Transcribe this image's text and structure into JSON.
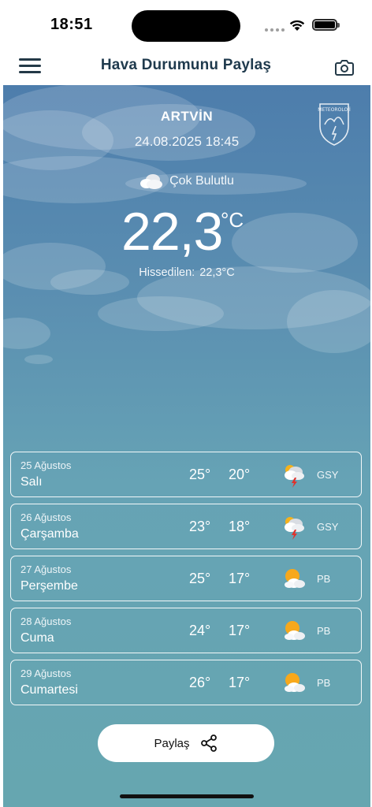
{
  "status_bar": {
    "time": "18:51"
  },
  "nav": {
    "title": "Hava Durumunu Paylaş"
  },
  "current": {
    "city": "ARTVİN",
    "datetime": "24.08.2025 18:45",
    "condition": "Çok Bulutlu",
    "temperature": "22,3",
    "unit": "°C",
    "feels_label": "Hissedilen:",
    "feels_value": "22,3°C",
    "logo_text": "METEOROLOJİ"
  },
  "forecast": [
    {
      "date": "25 Ağustos",
      "day": "Salı",
      "max": "25°",
      "min": "20°",
      "icon": "thunderstorm-icon",
      "code": "GSY"
    },
    {
      "date": "26 Ağustos",
      "day": "Çarşamba",
      "max": "23°",
      "min": "18°",
      "icon": "thunderstorm-icon",
      "code": "GSY"
    },
    {
      "date": "27 Ağustos",
      "day": "Perşembe",
      "max": "25°",
      "min": "17°",
      "icon": "partly-cloudy-icon",
      "code": "PB"
    },
    {
      "date": "28 Ağustos",
      "day": "Cuma",
      "max": "24°",
      "min": "17°",
      "icon": "partly-cloudy-icon",
      "code": "PB"
    },
    {
      "date": "29 Ağustos",
      "day": "Cumartesi",
      "max": "26°",
      "min": "17°",
      "icon": "partly-cloudy-icon",
      "code": "PB"
    }
  ],
  "share": {
    "label": "Paylaş"
  },
  "colors": {
    "sky_top": "#4d7dac",
    "sky_bottom": "#66a6b0",
    "nav_text": "#1f3a4d"
  }
}
